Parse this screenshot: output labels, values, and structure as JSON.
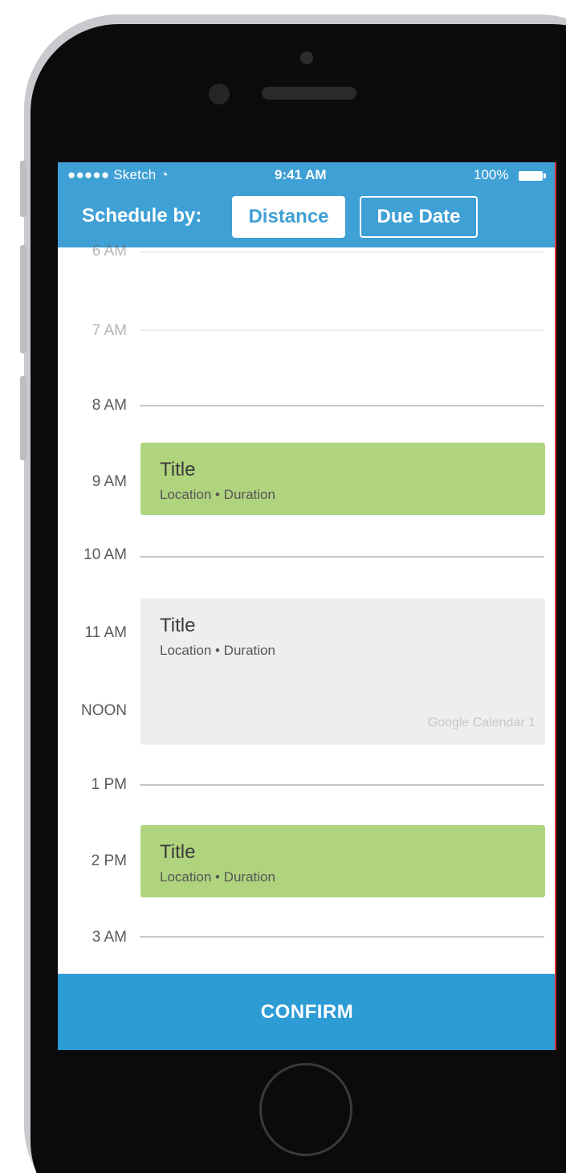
{
  "status_bar": {
    "carrier": "●●●●● Sketch",
    "time": "9:41 AM",
    "battery": "100%"
  },
  "header": {
    "schedule_label": "Schedule by:",
    "options": [
      "Distance",
      "Due Date"
    ],
    "selected": "Distance"
  },
  "hours": [
    "6 AM",
    "7 AM",
    "8 AM",
    "9 AM",
    "10 AM",
    "11 AM",
    "NOON",
    "1 PM",
    "2 PM",
    "3 AM"
  ],
  "events": [
    {
      "title": "Title",
      "subtitle": "Location • Duration",
      "color": "#b0d47e"
    },
    {
      "title": "Title",
      "subtitle": "Location • Duration",
      "calendar": "Google Calendar 1",
      "color": "#eeedef"
    },
    {
      "title": "Title",
      "subtitle": "Location • Duration",
      "color": "#b0d47e"
    }
  ],
  "confirm_label": "CONFIRM",
  "colors": {
    "header": "#3fa0d5",
    "confirm": "#2d9bd4",
    "event_green": "#b0d47e",
    "event_gray": "#eeedef"
  }
}
